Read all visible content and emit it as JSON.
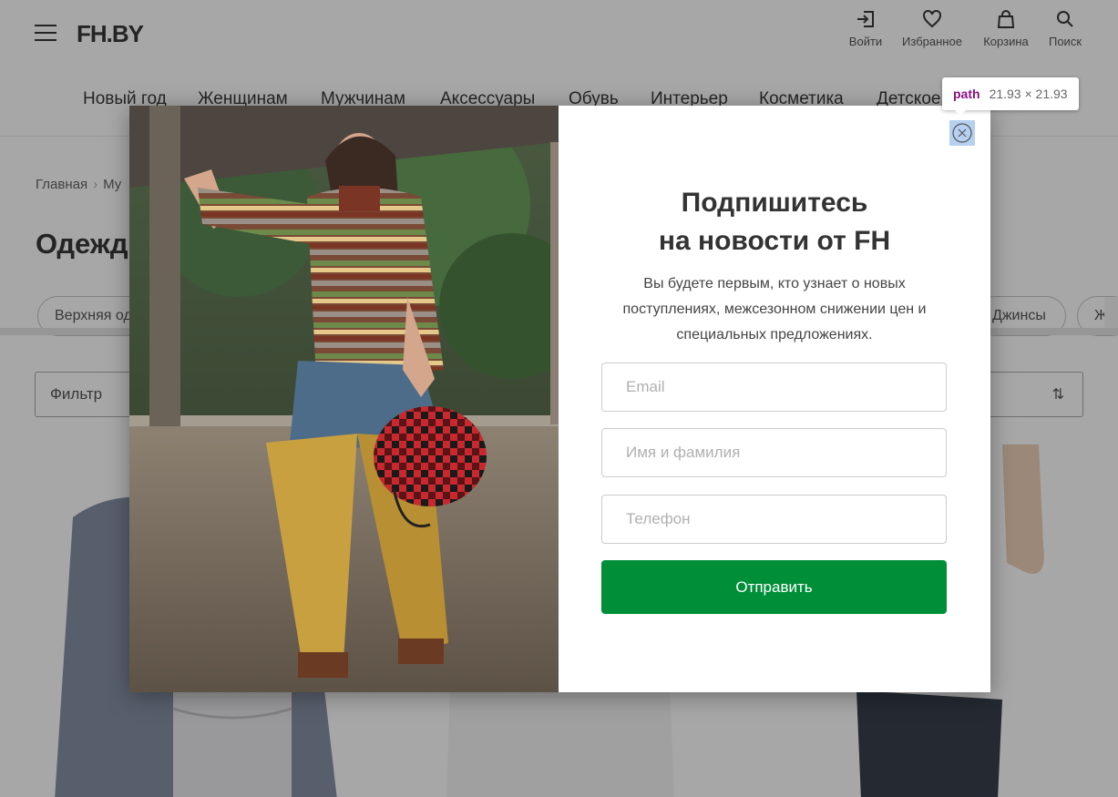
{
  "header": {
    "logo": "FH.BY",
    "login_label": "Войти",
    "favorites_label": "Избранное",
    "cart_label": "Корзина",
    "search_label": "Поиск"
  },
  "nav": {
    "items": [
      "Новый год",
      "Женщинам",
      "Мужчинам",
      "Аксессуары",
      "Обувь",
      "Интерьер",
      "Косметика",
      "Детское"
    ]
  },
  "breadcrumb": {
    "home": "Главная",
    "current": "Му"
  },
  "page_title": "Одежд",
  "chips": {
    "first": "Верхняя од",
    "jeans": "Джинсы",
    "last": "Ж"
  },
  "filter_label": "Фильтр",
  "sort_arrows": "⇅",
  "modal": {
    "title_line1": "Подпишитесь",
    "title_line2": "на новости от FH",
    "description": "Вы будете первым, кто узнает о новых поступлениях, межсезонном снижении цен и специальных предложениях.",
    "email_placeholder": "Email",
    "name_placeholder": "Имя и фамилия",
    "phone_placeholder": "Телефон",
    "submit_label": "Отправить"
  },
  "devtools_tooltip": {
    "tag": "path",
    "dims": "21.93 × 21.93"
  },
  "colors": {
    "submit_bg": "#008f39",
    "overlay": "rgba(60,60,60,0.45)"
  }
}
